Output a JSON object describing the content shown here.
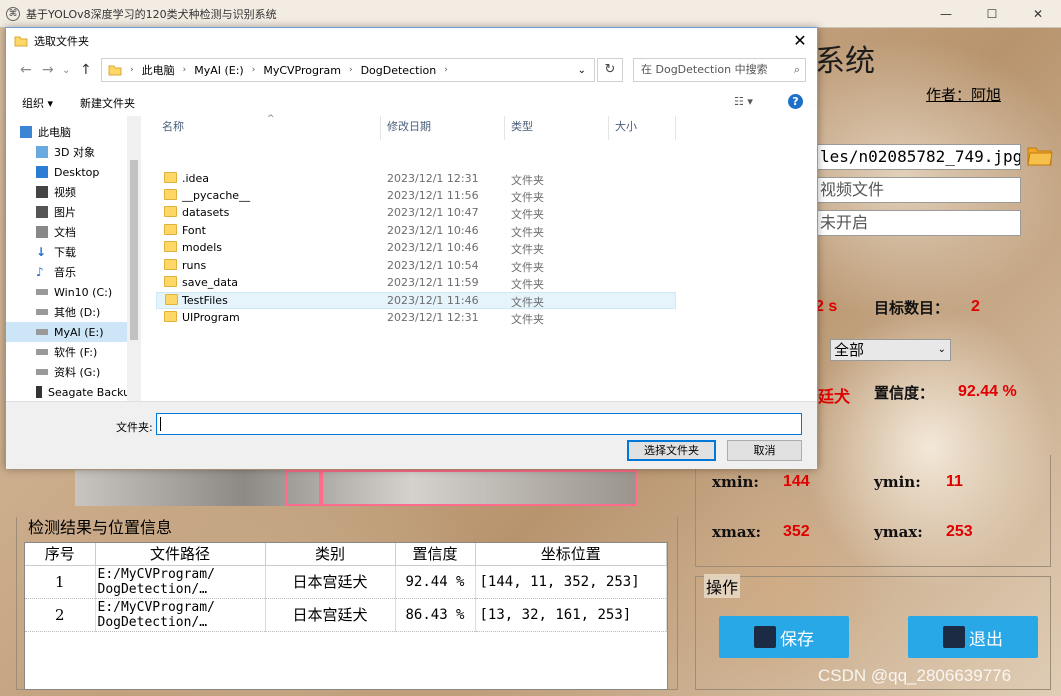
{
  "app": {
    "title": "基于YOLOv8深度学习的120类犬种检测与识别系统",
    "sys_title_visible": "系统",
    "author": "作者：阿旭"
  },
  "inputs": {
    "image_path": "les/n02085782_749.jpg",
    "video_placeholder": "视频文件",
    "camera_status": "未开启"
  },
  "stats": {
    "time_value": "2 s",
    "target_count_label": "目标数目：",
    "target_count_value": "2",
    "select_value": "全部",
    "class_value": "廷犬",
    "confidence_label": "置信度：",
    "confidence_value": "92.44 %"
  },
  "bbox": {
    "xmin_label": "xmin:",
    "xmin": "144",
    "ymin_label": "ymin:",
    "ymin": "11",
    "xmax_label": "xmax:",
    "xmax": "352",
    "ymax_label": "ymax:",
    "ymax": "253"
  },
  "operations": {
    "title": "操作",
    "save_label": "保存",
    "exit_label": "退出"
  },
  "results": {
    "title": "检测结果与位置信息",
    "headers": [
      "序号",
      "文件路径",
      "类别",
      "置信度",
      "坐标位置"
    ],
    "rows": [
      {
        "id": "1",
        "path1": "E:/MyCVProgram/",
        "path2": "DogDetection/…",
        "class": "日本宫廷犬",
        "conf": "92.44 %",
        "coord": "[144, 11, 352, 253]"
      },
      {
        "id": "2",
        "path1": "E:/MyCVProgram/",
        "path2": "DogDetection/…",
        "class": "日本宫廷犬",
        "conf": "86.43 %",
        "coord": "[13, 32, 161, 253]"
      }
    ]
  },
  "watermark": "CSDN @qq_2806639776",
  "dialog": {
    "title": "选取文件夹",
    "breadcrumbs": [
      "此电脑",
      "MyAI (E:)",
      "MyCVProgram",
      "DogDetection"
    ],
    "search_placeholder": "在 DogDetection 中搜索",
    "toolbar": {
      "organize": "组织 ▾",
      "new_folder": "新建文件夹",
      "help": "?"
    },
    "nav_items": [
      {
        "label": "此电脑",
        "icon": "pc-icon"
      },
      {
        "label": "3D 对象",
        "icon": "3d-objects-icon"
      },
      {
        "label": "Desktop",
        "icon": "desktop-icon"
      },
      {
        "label": "视频",
        "icon": "video-icon"
      },
      {
        "label": "图片",
        "icon": "pictures-icon"
      },
      {
        "label": "文档",
        "icon": "documents-icon"
      },
      {
        "label": "下载",
        "icon": "download-icon"
      },
      {
        "label": "音乐",
        "icon": "music-icon"
      },
      {
        "label": "Win10 (C:)",
        "icon": "drive-icon"
      },
      {
        "label": "其他 (D:)",
        "icon": "drive-icon"
      },
      {
        "label": "MyAI (E:)",
        "icon": "drive-icon"
      },
      {
        "label": "软件 (F:)",
        "icon": "drive-icon"
      },
      {
        "label": "资料 (G:)",
        "icon": "drive-icon"
      },
      {
        "label": "Seagate Backu",
        "icon": "drive-icon"
      }
    ],
    "columns": {
      "name": "名称",
      "date": "修改日期",
      "type": "类型",
      "size": "大小"
    },
    "files": [
      {
        "name": ".idea",
        "date": "2023/12/1 12:31",
        "type": "文件夹"
      },
      {
        "name": "__pycache__",
        "date": "2023/12/1 11:56",
        "type": "文件夹"
      },
      {
        "name": "datasets",
        "date": "2023/12/1 10:47",
        "type": "文件夹"
      },
      {
        "name": "Font",
        "date": "2023/12/1 10:46",
        "type": "文件夹"
      },
      {
        "name": "models",
        "date": "2023/12/1 10:46",
        "type": "文件夹"
      },
      {
        "name": "runs",
        "date": "2023/12/1 10:54",
        "type": "文件夹"
      },
      {
        "name": "save_data",
        "date": "2023/12/1 11:59",
        "type": "文件夹"
      },
      {
        "name": "TestFiles",
        "date": "2023/12/1 11:46",
        "type": "文件夹"
      },
      {
        "name": "UIProgram",
        "date": "2023/12/1 12:31",
        "type": "文件夹"
      }
    ],
    "folder_label": "文件夹:",
    "select_button": "选择文件夹",
    "cancel_button": "取消"
  }
}
